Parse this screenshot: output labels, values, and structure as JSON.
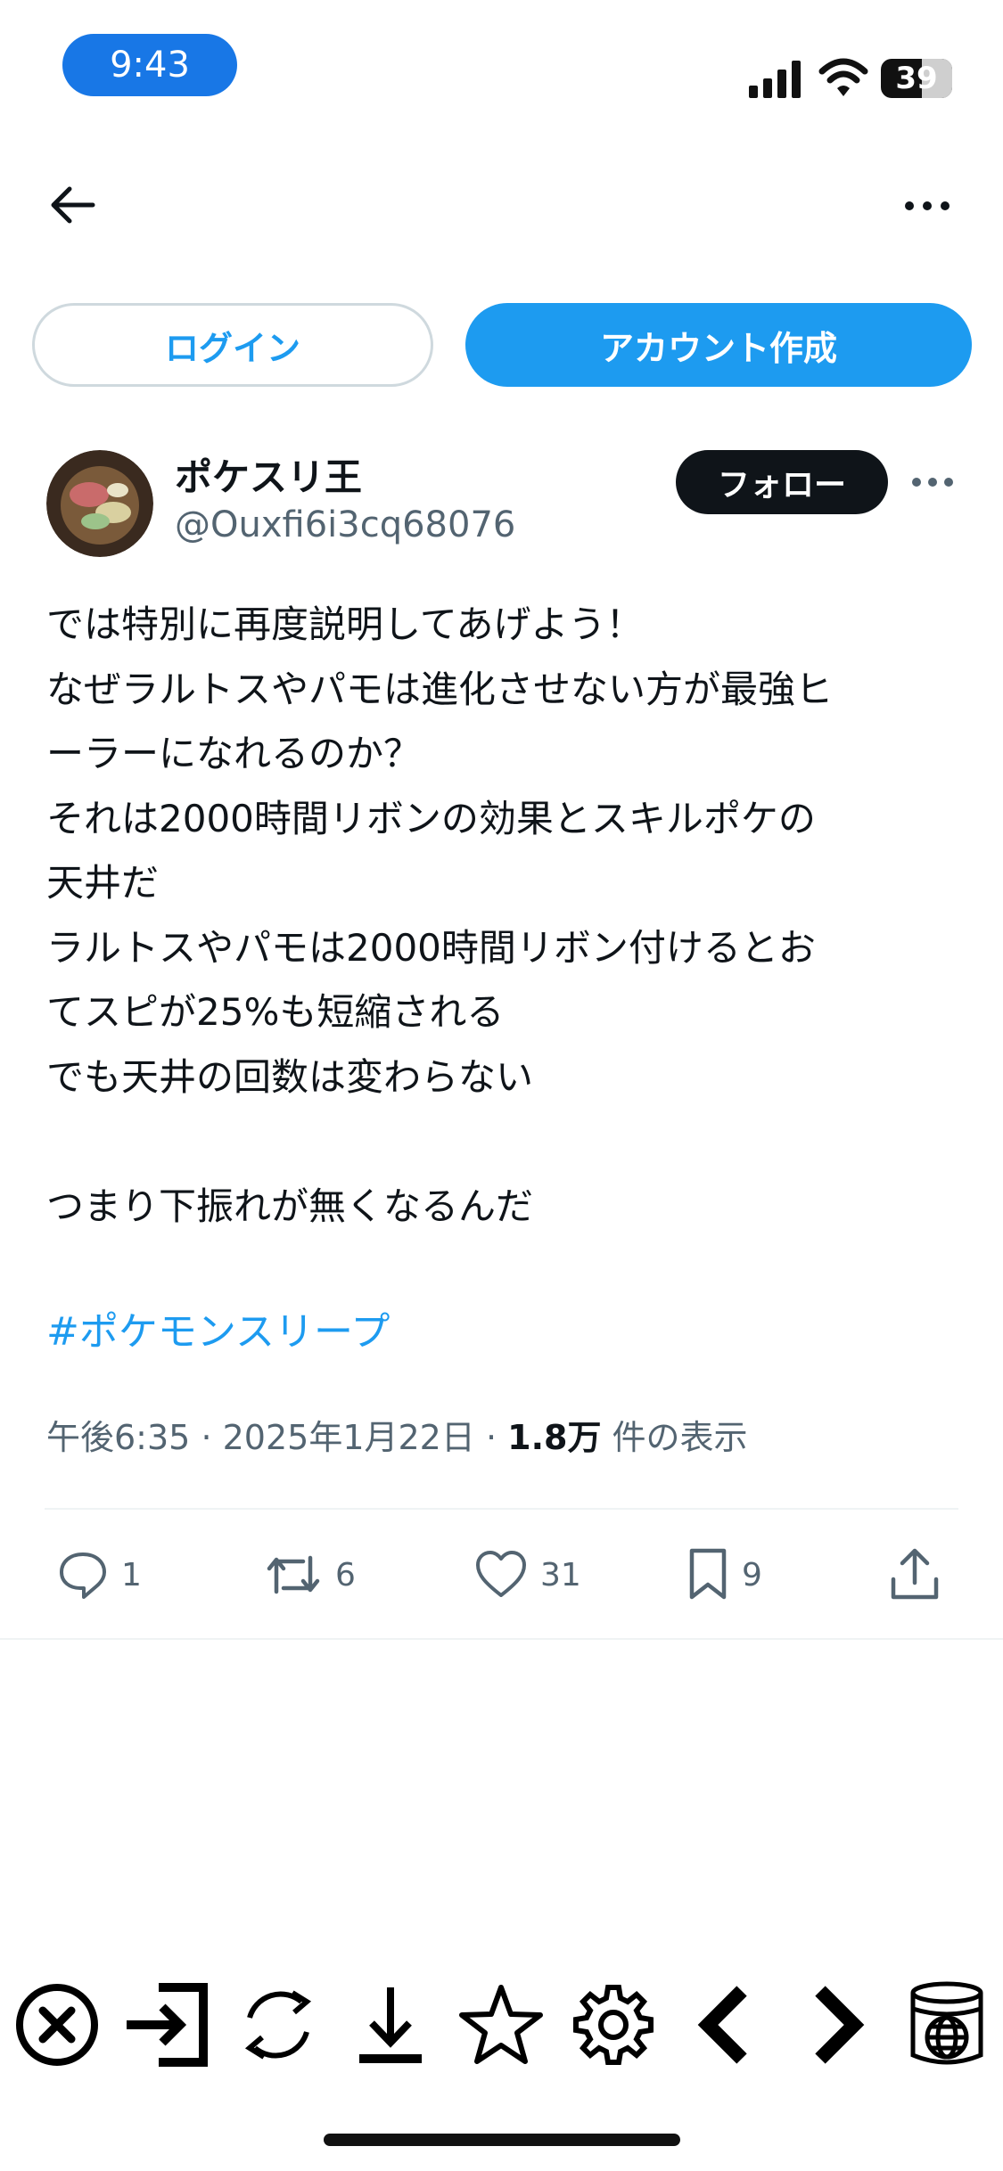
{
  "status_bar": {
    "time": "9:43",
    "battery": "39"
  },
  "auth": {
    "login_label": "ログイン",
    "signup_label": "アカウント作成"
  },
  "author": {
    "name": "ポケスリ王",
    "handle": "@Ouxfi6i3cq68076",
    "follow_label": "フォロー"
  },
  "tweet": {
    "lines": [
      "では特別に再度説明してあげよう！",
      "なぜラルトスやパモは進化させない方が最強ヒ",
      "ーラーになれるのか？",
      "それは2000時間リボンの効果とスキルポケの",
      "天井だ",
      "ラルトスやパモは2000時間リボン付けるとお",
      "てスピが25%も短縮される",
      "でも天井の回数は変わらない",
      "",
      "つまり下振れが無くなるんだ"
    ],
    "hashtag": "#ポケモンスリープ",
    "time": "午後6:35",
    "date": "2025年1月22日",
    "views": "1.8万",
    "views_label": "件の表示"
  },
  "actions": {
    "replies": "1",
    "retweets": "6",
    "likes": "31",
    "bookmarks": "9"
  },
  "browser_toolbar": {
    "icons": [
      "close-icon",
      "login-icon",
      "refresh-icon",
      "download-icon",
      "star-icon",
      "gear-icon",
      "chevron-left-icon",
      "chevron-right-icon",
      "database-globe-icon"
    ]
  },
  "colors": {
    "accent": "#1d9bf0",
    "text": "#0f1419",
    "muted": "#536471",
    "status_pill": "#1877e6"
  }
}
